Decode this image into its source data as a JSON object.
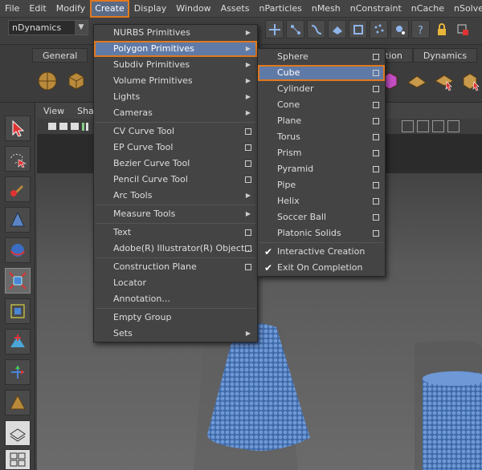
{
  "menubar": {
    "items": [
      "File",
      "Edit",
      "Modify",
      "Create",
      "Display",
      "Window",
      "Assets",
      "nParticles",
      "nMesh",
      "nConstraint",
      "nCache",
      "nSolver"
    ],
    "active_index": 3
  },
  "statusline": {
    "mode_value": "nDynamics"
  },
  "shelf": {
    "tabs": [
      "General"
    ],
    "right_tabs": [
      "ation",
      "Dynamics"
    ]
  },
  "viewport": {
    "menu": [
      "View",
      "Shad"
    ]
  },
  "create_menu": {
    "items": [
      {
        "label": "NURBS Primitives",
        "type": "submenu"
      },
      {
        "label": "Polygon Primitives",
        "type": "submenu",
        "highlighted": true
      },
      {
        "label": "Subdiv Primitives",
        "type": "submenu"
      },
      {
        "label": "Volume Primitives",
        "type": "submenu"
      },
      {
        "label": "Lights",
        "type": "submenu"
      },
      {
        "label": "Cameras",
        "type": "submenu"
      },
      {
        "label": "CV Curve Tool",
        "type": "option"
      },
      {
        "label": "EP Curve Tool",
        "type": "option"
      },
      {
        "label": "Bezier Curve Tool",
        "type": "option"
      },
      {
        "label": "Pencil Curve Tool",
        "type": "option"
      },
      {
        "label": "Arc Tools",
        "type": "submenu"
      },
      {
        "label": "Measure Tools",
        "type": "submenu"
      },
      {
        "label": "Text",
        "type": "option"
      },
      {
        "label": "Adobe(R) Illustrator(R) Object...",
        "type": "option"
      },
      {
        "label": "Construction Plane",
        "type": "option"
      },
      {
        "label": "Locator",
        "type": "plain"
      },
      {
        "label": "Annotation...",
        "type": "plain"
      },
      {
        "label": "Empty Group",
        "type": "plain"
      },
      {
        "label": "Sets",
        "type": "submenu"
      }
    ]
  },
  "polygon_menu": {
    "items": [
      {
        "label": "Sphere",
        "type": "option"
      },
      {
        "label": "Cube",
        "type": "option",
        "highlighted": true
      },
      {
        "label": "Cylinder",
        "type": "option"
      },
      {
        "label": "Cone",
        "type": "option"
      },
      {
        "label": "Plane",
        "type": "option"
      },
      {
        "label": "Torus",
        "type": "option"
      },
      {
        "label": "Prism",
        "type": "option"
      },
      {
        "label": "Pyramid",
        "type": "option"
      },
      {
        "label": "Pipe",
        "type": "option"
      },
      {
        "label": "Helix",
        "type": "option"
      },
      {
        "label": "Soccer Ball",
        "type": "option"
      },
      {
        "label": "Platonic Solids",
        "type": "option"
      },
      {
        "label": "Interactive Creation",
        "type": "check",
        "checked": true
      },
      {
        "label": "Exit On Completion",
        "type": "check",
        "checked": true
      }
    ]
  },
  "colors": {
    "highlight": "#5f7aa6",
    "accent_outline": "#e0781e",
    "mesh_blue": "#5b84c4"
  }
}
